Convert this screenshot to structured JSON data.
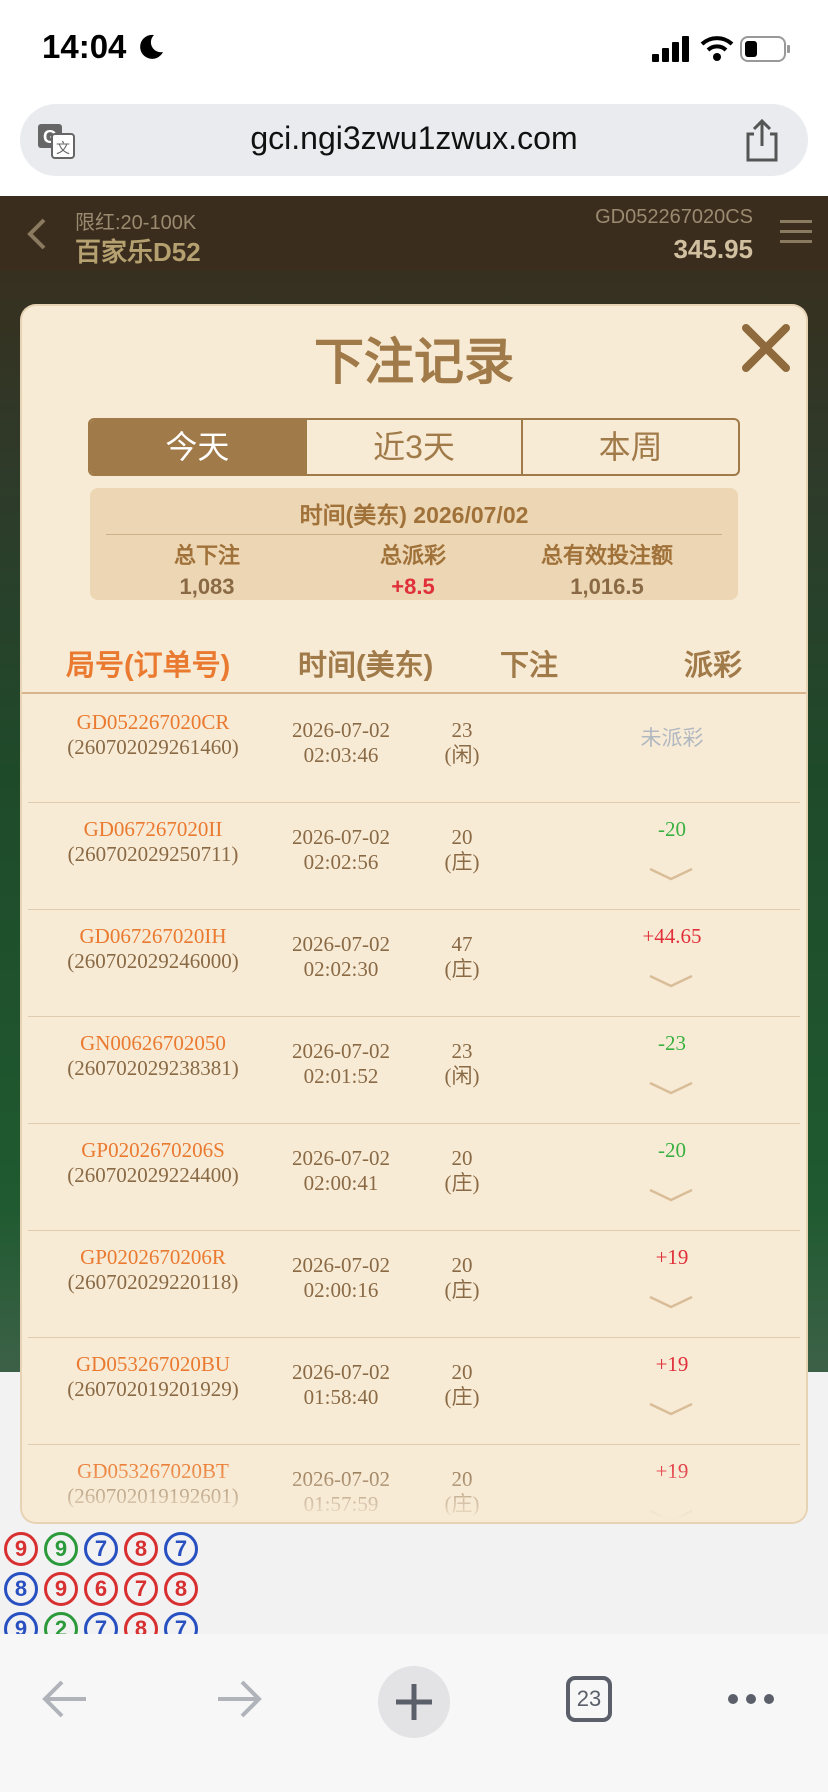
{
  "status_bar": {
    "time": "14:04"
  },
  "browser": {
    "url": "gci.ngi3zwu1zwux.com",
    "tab_count": "23"
  },
  "game": {
    "limit": "限红:20-100K",
    "table_name": "百家乐D52",
    "round_id": "GD052267020CS",
    "balance": "345.95",
    "beads": [
      {
        "v": "9",
        "c": "red"
      },
      {
        "v": "9",
        "c": "green"
      },
      {
        "v": "7",
        "c": "blue"
      },
      {
        "v": "8",
        "c": "red"
      },
      {
        "v": "7",
        "c": "blue"
      },
      {
        "v": "8",
        "c": "blue"
      },
      {
        "v": "9",
        "c": "red"
      },
      {
        "v": "6",
        "c": "red"
      },
      {
        "v": "7",
        "c": "red"
      },
      {
        "v": "8",
        "c": "red"
      },
      {
        "v": "9",
        "c": "blue"
      },
      {
        "v": "2",
        "c": "green"
      },
      {
        "v": "7",
        "c": "blue"
      },
      {
        "v": "8",
        "c": "red"
      },
      {
        "v": "7",
        "c": "blue"
      }
    ]
  },
  "modal": {
    "title": "下注记录",
    "tabs": [
      {
        "label": "今天",
        "active": true
      },
      {
        "label": "近3天",
        "active": false
      },
      {
        "label": "本周",
        "active": false
      }
    ],
    "summary": {
      "time_label": "时间(美东)  2026/07/02",
      "total_bet_label": "总下注",
      "total_bet": "1,083",
      "total_payout_label": "总派彩",
      "total_payout": "+8.5",
      "total_valid_label": "总有效投注额",
      "total_valid": "1,016.5"
    },
    "columns": {
      "id": "局号(订单号)",
      "time": "时间(美东)",
      "bet": "下注",
      "payout": "派彩"
    },
    "rows": [
      {
        "round": "GD052267020CR",
        "order": "(260702029261460)",
        "date": "2026-07-02",
        "clock": "02:03:46",
        "amount": "23",
        "side": "(闲)",
        "payout": "未派彩",
        "status": "none"
      },
      {
        "round": "GD067267020II",
        "order": "(260702029250711)",
        "date": "2026-07-02",
        "clock": "02:02:56",
        "amount": "20",
        "side": "(庄)",
        "payout": "-20",
        "status": "loss"
      },
      {
        "round": "GD067267020IH",
        "order": "(260702029246000)",
        "date": "2026-07-02",
        "clock": "02:02:30",
        "amount": "47",
        "side": "(庄)",
        "payout": "+44.65",
        "status": "win"
      },
      {
        "round": "GN00626702050",
        "order": "(260702029238381)",
        "date": "2026-07-02",
        "clock": "02:01:52",
        "amount": "23",
        "side": "(闲)",
        "payout": "-23",
        "status": "loss"
      },
      {
        "round": "GP0202670206S",
        "order": "(260702029224400)",
        "date": "2026-07-02",
        "clock": "02:00:41",
        "amount": "20",
        "side": "(庄)",
        "payout": "-20",
        "status": "loss"
      },
      {
        "round": "GP0202670206R",
        "order": "(260702029220118)",
        "date": "2026-07-02",
        "clock": "02:00:16",
        "amount": "20",
        "side": "(庄)",
        "payout": "+19",
        "status": "win"
      },
      {
        "round": "GD053267020BU",
        "order": "(260702019201929)",
        "date": "2026-07-02",
        "clock": "01:58:40",
        "amount": "20",
        "side": "(庄)",
        "payout": "+19",
        "status": "win"
      },
      {
        "round": "GD053267020BT",
        "order": "(260702019192601)",
        "date": "2026-07-02",
        "clock": "01:57:59",
        "amount": "20",
        "side": "(庄)",
        "payout": "+19",
        "status": "win"
      }
    ]
  }
}
